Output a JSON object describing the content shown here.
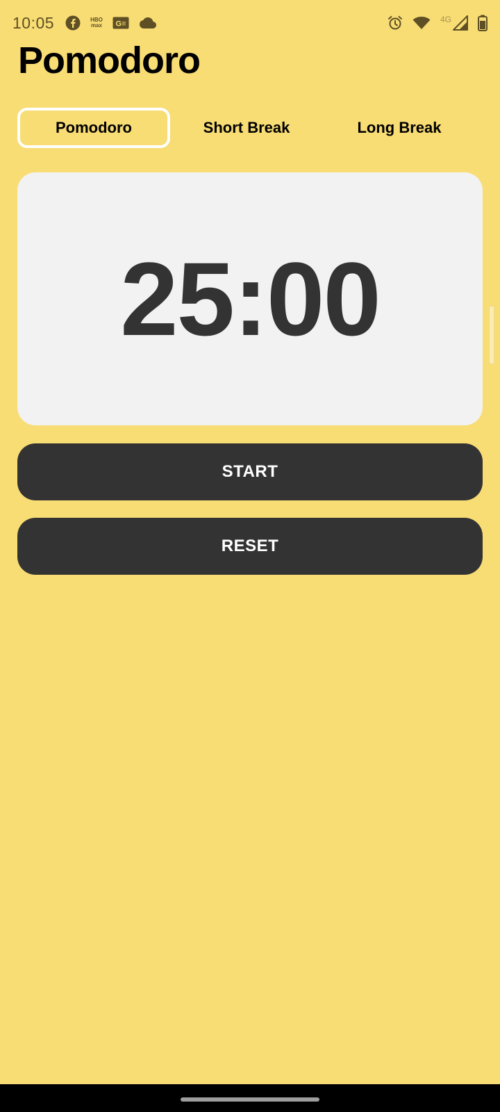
{
  "status_bar": {
    "time": "10:05",
    "notification_icons": [
      "facebook-icon",
      "hbo-max-icon",
      "news-icon",
      "cloud-icon"
    ],
    "hbo_text_top": "HBO",
    "hbo_text_bottom": "max",
    "news_text": "G≡",
    "network_label": "4G",
    "system_icons": [
      "alarm-icon",
      "wifi-icon",
      "cellular-signal-icon",
      "battery-icon"
    ]
  },
  "app": {
    "title": "Pomodoro"
  },
  "tabs": [
    {
      "label": "Pomodoro",
      "active": true
    },
    {
      "label": "Short Break",
      "active": false
    },
    {
      "label": "Long Break",
      "active": false
    }
  ],
  "timer": {
    "display": "25:00"
  },
  "controls": {
    "start_label": "START",
    "reset_label": "RESET"
  },
  "colors": {
    "background": "#F8DC74",
    "card": "#F2F2F2",
    "button": "#333333",
    "button_text": "#FFFFFF",
    "active_tab_border": "#FFFFFF"
  }
}
